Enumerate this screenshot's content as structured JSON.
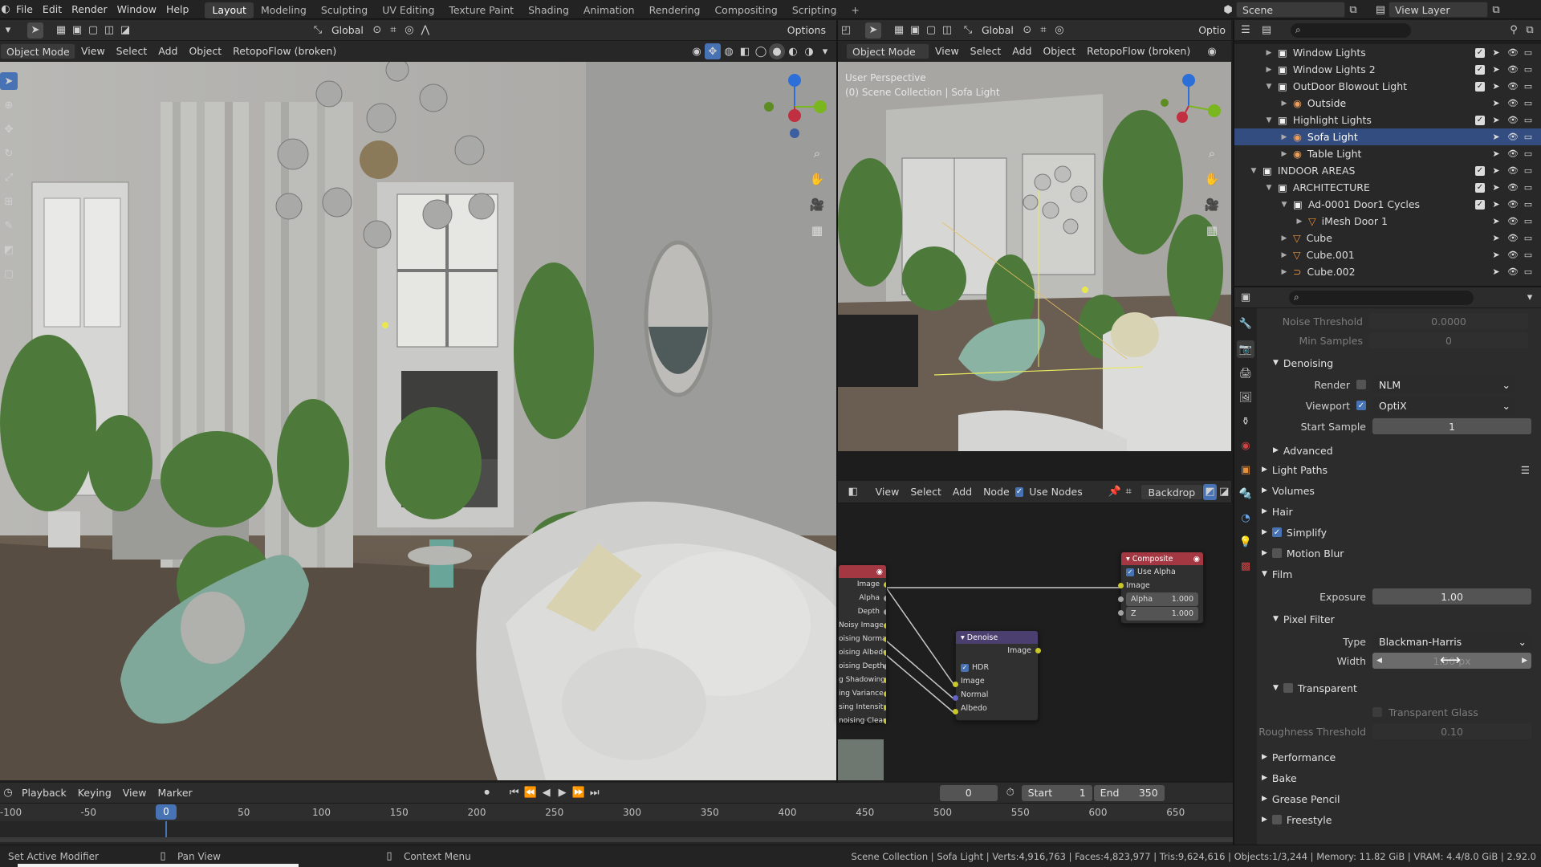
{
  "menus": [
    "File",
    "Edit",
    "Render",
    "Window",
    "Help"
  ],
  "workspaces": [
    "Layout",
    "Modeling",
    "Sculpting",
    "UV Editing",
    "Texture Paint",
    "Shading",
    "Animation",
    "Rendering",
    "Compositing",
    "Scripting"
  ],
  "workspace_add": "+",
  "scene": {
    "name": "Scene",
    "view_layer": "View Layer"
  },
  "left_vp": {
    "transform": "Global",
    "options": "Options",
    "mode": "Object Mode",
    "menu": [
      "View",
      "Select",
      "Add",
      "Object"
    ],
    "addon": "RetopoFlow (broken)"
  },
  "right_vp": {
    "transform": "Global",
    "options": "Optio",
    "mode": "Object Mode",
    "menu": [
      "View",
      "Select",
      "Add",
      "Object"
    ],
    "addon": "RetopoFlow (broken)",
    "info_line1": "User Perspective",
    "info_line2": "(0) Scene Collection | Sofa Light"
  },
  "gizmo": {
    "z": "Z",
    "y": "Y",
    "x": "X"
  },
  "compositor": {
    "menu": [
      "View",
      "Select",
      "Add",
      "Node"
    ],
    "use_nodes": "Use Nodes",
    "backdrop": "Backdrop",
    "render_layers_outputs": [
      "Image",
      "Alpha",
      "Depth",
      "Noisy Image",
      "oising Normal",
      "oising Albedo",
      "oising Depth",
      "g Shadowing",
      "ing Variance",
      "sing Intensity",
      "noising Clean"
    ],
    "composite": {
      "title": "Composite",
      "use_alpha": "Use Alpha",
      "inputs": [
        "Image",
        "Alpha",
        "Z"
      ],
      "alpha_val": "1.000",
      "z_val": "1.000"
    },
    "denoise": {
      "title": "Denoise",
      "output": "Image",
      "hdr": "HDR",
      "inputs": [
        "Image",
        "Normal",
        "Albedo"
      ]
    }
  },
  "outliner": [
    {
      "indent": 3,
      "label": "Window Lights",
      "type": "collection",
      "check": true
    },
    {
      "indent": 3,
      "label": "Window Lights 2",
      "type": "collection",
      "check": true
    },
    {
      "indent": 3,
      "label": "OutDoor Blowout Light",
      "type": "collection",
      "check": true,
      "open": true
    },
    {
      "indent": 4,
      "label": "Outside",
      "type": "light",
      "check": null
    },
    {
      "indent": 3,
      "label": "Highlight Lights",
      "type": "collection",
      "check": true,
      "open": true
    },
    {
      "indent": 4,
      "label": "Sofa Light",
      "type": "light",
      "check": null,
      "selected": true
    },
    {
      "indent": 4,
      "label": "Table Light",
      "type": "light",
      "check": null
    },
    {
      "indent": 2,
      "label": "INDOOR AREAS",
      "type": "collection",
      "check": true,
      "open": true
    },
    {
      "indent": 3,
      "label": "ARCHITECTURE",
      "type": "collection",
      "check": true,
      "open": true
    },
    {
      "indent": 4,
      "label": "Ad-0001 Door1 Cycles",
      "type": "collection",
      "check": true,
      "open": true
    },
    {
      "indent": 5,
      "label": "iMesh Door 1",
      "type": "mesh",
      "check": null
    },
    {
      "indent": 4,
      "label": "Cube",
      "type": "mesh",
      "check": null
    },
    {
      "indent": 4,
      "label": "Cube.001",
      "type": "mesh",
      "check": null
    },
    {
      "indent": 4,
      "label": "Cube.002",
      "type": "curve",
      "check": null
    }
  ],
  "props": {
    "noise_threshold": {
      "label": "Noise Threshold",
      "value": "0.0000"
    },
    "min_samples": {
      "label": "Min Samples",
      "value": "0"
    },
    "denoising": "Denoising",
    "render": {
      "label": "Render",
      "value": "NLM"
    },
    "viewport": {
      "label": "Viewport",
      "value": "OptiX"
    },
    "start_sample": {
      "label": "Start Sample",
      "value": "1"
    },
    "advanced": "Advanced",
    "light_paths": "Light Paths",
    "volumes": "Volumes",
    "hair": "Hair",
    "simplify": "Simplify",
    "motion_blur": "Motion Blur",
    "film": "Film",
    "exposure": {
      "label": "Exposure",
      "value": "1.00"
    },
    "pixel_filter": "Pixel Filter",
    "type": {
      "label": "Type",
      "value": "Blackman-Harris"
    },
    "width": {
      "label": "Width",
      "value": "1.50 px"
    },
    "transparent": "Transparent",
    "transparent_glass": "Transparent Glass",
    "roughness_threshold": {
      "label": "Roughness Threshold",
      "value": "0.10"
    },
    "performance": "Performance",
    "bake": "Bake",
    "grease_pencil": "Grease Pencil",
    "freestyle": "Freestyle"
  },
  "timeline": {
    "menu": [
      "Playback",
      "Keying",
      "View",
      "Marker"
    ],
    "current": "0",
    "start_label": "Start",
    "start": "1",
    "end_label": "End",
    "end": "350",
    "ticks": [
      "-100",
      "-50",
      "0",
      "50",
      "100",
      "150",
      "200",
      "250",
      "300",
      "350",
      "400",
      "450",
      "500",
      "550",
      "600",
      "650"
    ],
    "playhead": "0"
  },
  "status": {
    "left": "Set Active Modifier",
    "mid": "Pan View",
    "ctx": "Context Menu",
    "right": "Scene Collection | Sofa Light | Verts:4,916,763 | Faces:4,823,977 | Tris:9,624,616 | Objects:1/3,244 | Memory: 11.82 GiB | VRAM: 4.4/8.0 GiB | 2.92.0"
  }
}
